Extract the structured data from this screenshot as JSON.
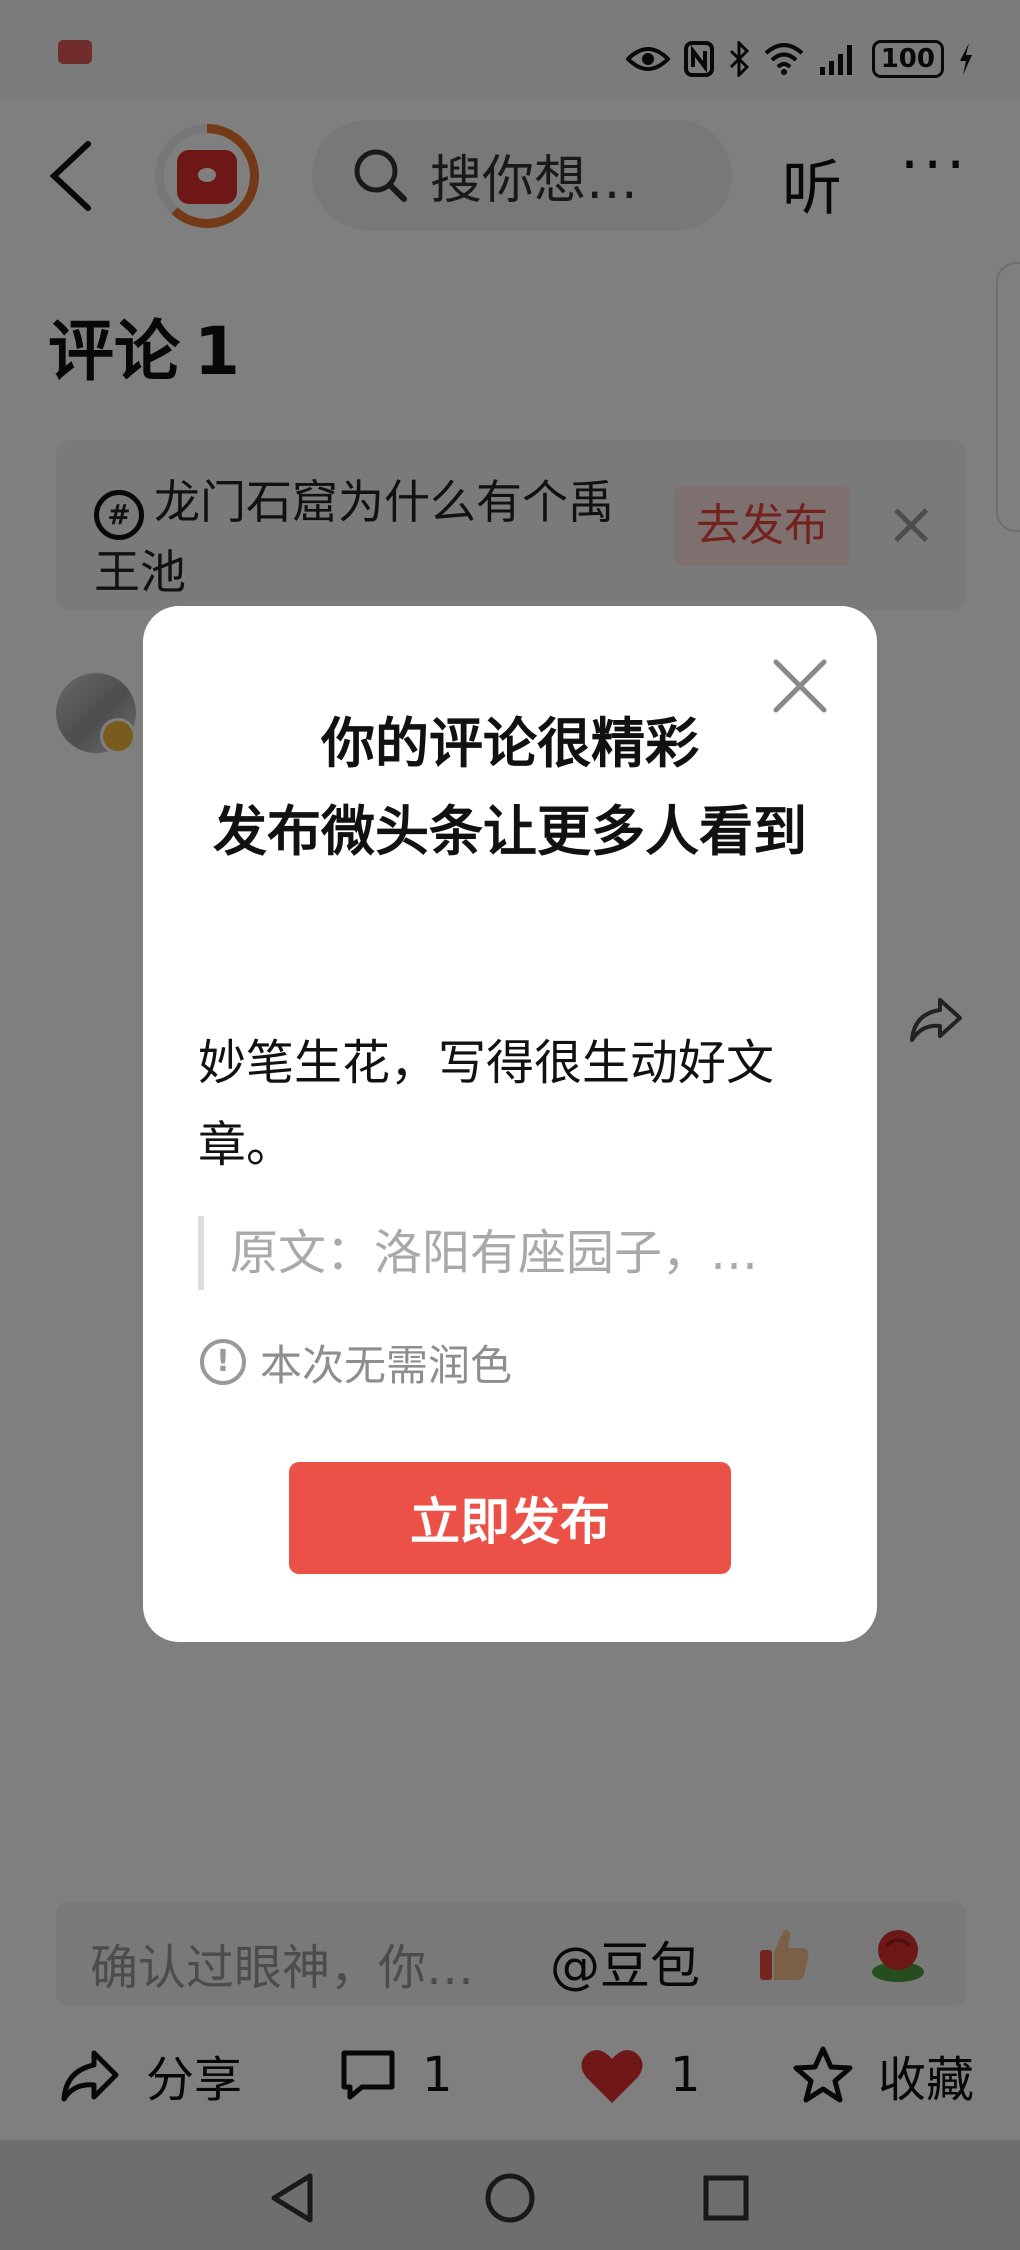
{
  "status_bar": {
    "left_text": "",
    "battery": "100"
  },
  "top_nav": {
    "search_placeholder": "搜你想…",
    "listen_label": "听",
    "more_label": "···"
  },
  "comments": {
    "title": "评论",
    "count": "1"
  },
  "topic_card": {
    "hash_symbol": "#",
    "text": "龙门石窟为什么有个禹王池",
    "publish_label": "去发布",
    "close_label": "×"
  },
  "modal": {
    "title_line1": "你的评论很精彩",
    "title_line2": "发布微头条让更多人看到",
    "body": "妙笔生花，写得很生动好文章。",
    "quote": "原文：洛阳有座园子，…",
    "hint_symbol": "!",
    "hint": "本次无需润色",
    "publish_button": "立即发布"
  },
  "comment_input": {
    "placeholder": "确认过眼神，你…",
    "mention": "@豆包"
  },
  "bottom_bar": {
    "share_label": "分享",
    "comment_count": "1",
    "like_count": "1",
    "favorite_label": "收藏"
  },
  "colors": {
    "accent": "#ec5147",
    "tag_bg": "#fbe0df",
    "overlay": "rgba(0,0,0,0.5)"
  }
}
